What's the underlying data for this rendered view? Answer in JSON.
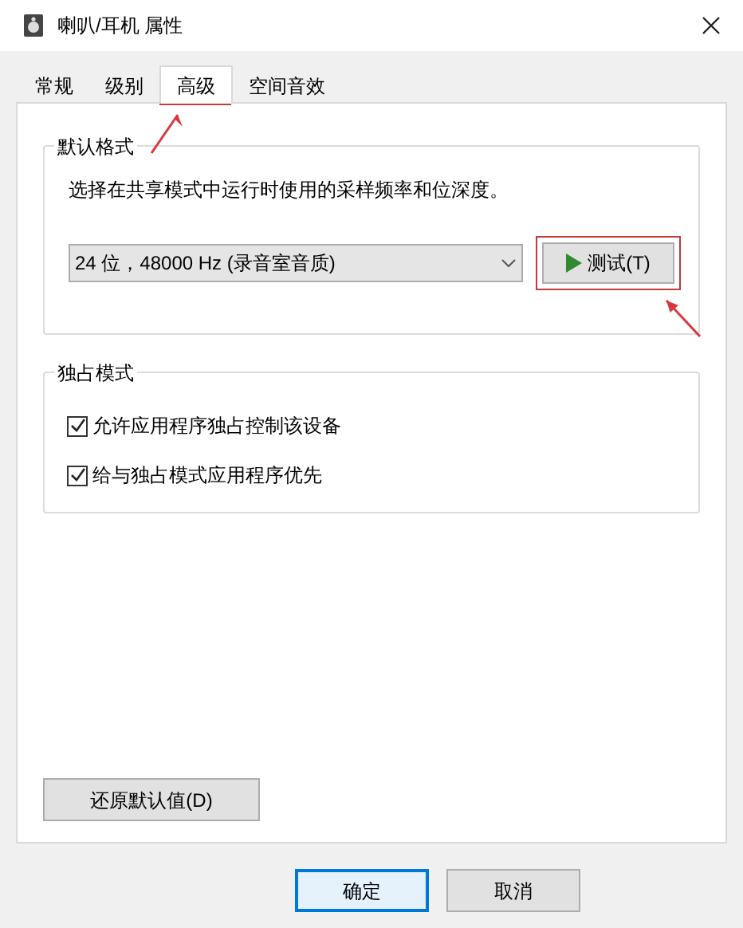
{
  "window": {
    "title": "喇叭/耳机 属性"
  },
  "tabs": [
    {
      "label": "常规",
      "selected": false
    },
    {
      "label": "级别",
      "selected": false
    },
    {
      "label": "高级",
      "selected": true
    },
    {
      "label": "空间音效",
      "selected": false
    }
  ],
  "default_format": {
    "title": "默认格式",
    "description": "选择在共享模式中运行时使用的采样频率和位深度。",
    "format": "24 位，48000 Hz (录音室音质)",
    "test_button": "测试(T)"
  },
  "exclusive_mode": {
    "title": "独占模式",
    "options": [
      {
        "label": "允许应用程序独占控制该设备",
        "checked": true
      },
      {
        "label": "给与独占模式应用程序优先",
        "checked": true
      }
    ]
  },
  "restore_button": "还原默认值(D)",
  "buttons": [
    {
      "label": "确定",
      "kind": "default"
    },
    {
      "label": "取消",
      "kind": "normal"
    }
  ]
}
